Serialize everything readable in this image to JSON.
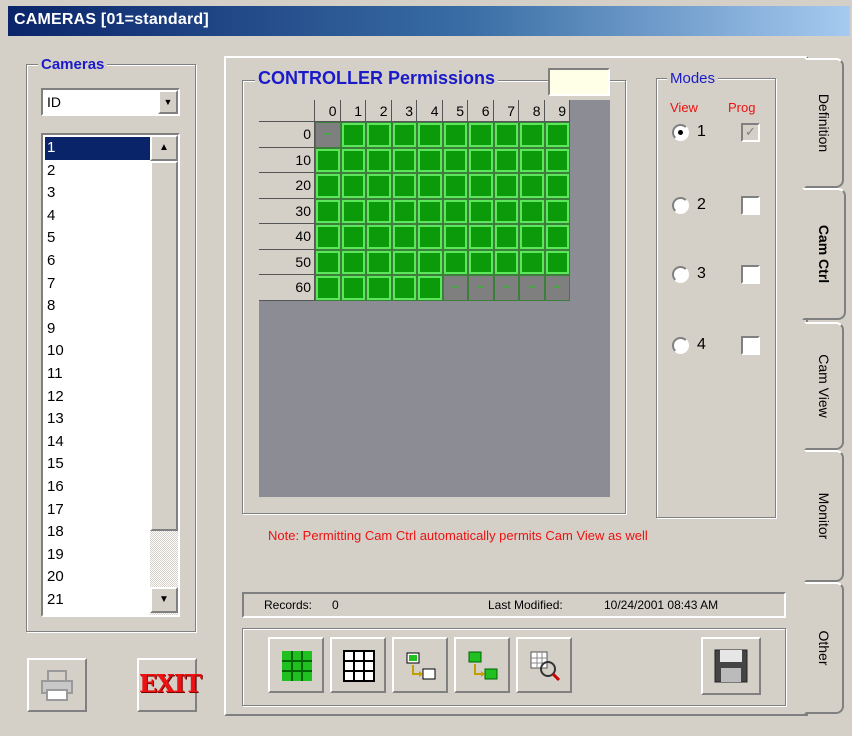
{
  "window": {
    "title": "CAMERAS  [01=standard]"
  },
  "cameras_panel": {
    "legend": "Cameras",
    "sort_combo": "ID",
    "list_items": [
      "1",
      "2",
      "3",
      "4",
      "5",
      "6",
      "7",
      "8",
      "9",
      "10",
      "11",
      "12",
      "13",
      "14",
      "15",
      "16",
      "17",
      "18",
      "19",
      "20",
      "21"
    ],
    "selected": "1"
  },
  "controller": {
    "title": "CONTROLLER Permissions",
    "field_value": "",
    "col_headers": [
      "0",
      "1",
      "2",
      "3",
      "4",
      "5",
      "6",
      "7",
      "8",
      "9"
    ],
    "row_headers": [
      "0",
      "10",
      "20",
      "30",
      "40",
      "50",
      "60"
    ],
    "permissions": [
      [
        0,
        1,
        1,
        1,
        1,
        1,
        1,
        1,
        1,
        1
      ],
      [
        1,
        1,
        1,
        1,
        1,
        1,
        1,
        1,
        1,
        1
      ],
      [
        1,
        1,
        1,
        1,
        1,
        1,
        1,
        1,
        1,
        1
      ],
      [
        1,
        1,
        1,
        1,
        1,
        1,
        1,
        1,
        1,
        1
      ],
      [
        1,
        1,
        1,
        1,
        1,
        1,
        1,
        1,
        1,
        1
      ],
      [
        1,
        1,
        1,
        1,
        1,
        1,
        1,
        1,
        1,
        1
      ],
      [
        1,
        1,
        1,
        1,
        1,
        0,
        0,
        0,
        0,
        0
      ]
    ],
    "note": "Note: Permitting Cam Ctrl automatically permits Cam View as well"
  },
  "modes": {
    "legend": "Modes",
    "view_header": "View",
    "prog_header": "Prog",
    "items": [
      {
        "num": "1",
        "view_selected": true,
        "prog_checked": true,
        "prog_disabled": true
      },
      {
        "num": "2",
        "view_selected": false,
        "prog_checked": false,
        "prog_disabled": false
      },
      {
        "num": "3",
        "view_selected": false,
        "prog_checked": false,
        "prog_disabled": false
      },
      {
        "num": "4",
        "view_selected": false,
        "prog_checked": false,
        "prog_disabled": false
      }
    ]
  },
  "status": {
    "records_label": "Records:",
    "records_value": "0",
    "modified_label": "Last Modified:",
    "modified_value": "10/24/2001 08:43 AM"
  },
  "tabs": [
    {
      "label": "Definition",
      "active": false
    },
    {
      "label": "Cam Ctrl",
      "active": true
    },
    {
      "label": "Cam View",
      "active": false
    },
    {
      "label": "Monitor",
      "active": false
    },
    {
      "label": "Other",
      "active": false
    }
  ],
  "buttons": {
    "exit_label": "EXIT"
  },
  "colors": {
    "title_start": "#0a246a",
    "permit_green": "#0a9a0a",
    "note_red": "#ee1111",
    "legend_blue": "#1a1acb"
  }
}
